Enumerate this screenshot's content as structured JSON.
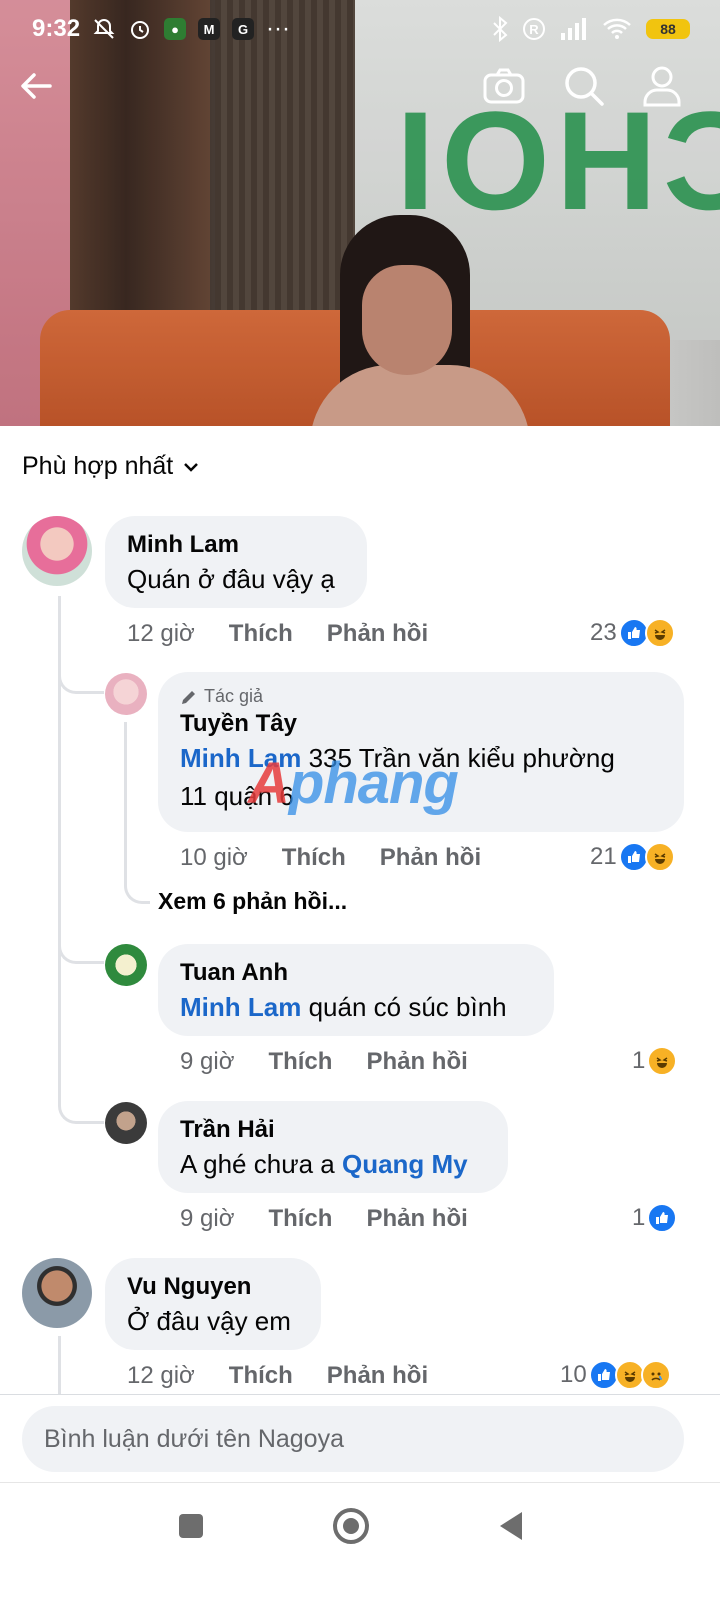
{
  "status_bar": {
    "time": "9:32",
    "battery": "88",
    "app_icons": [
      "M",
      "G"
    ],
    "more": "···"
  },
  "header": {
    "back_icon": "arrow-left-icon",
    "camera_icon": "camera-icon",
    "search_icon": "search-icon",
    "profile_icon": "profile-icon"
  },
  "sort": {
    "label": "Phù hợp nhất"
  },
  "comments": [
    {
      "name": "Minh Lam",
      "text": "Quán ở đâu vậy ạ",
      "time": "12 giờ",
      "like": "Thích",
      "reply": "Phản hồi",
      "reaction_count": "23"
    },
    {
      "author_tag": "Tác giả",
      "name": "Tuyền Tây",
      "mention": "Minh Lam",
      "text_line1": "335 Trần văn kiểu phường",
      "text_line2": "11 quận 6",
      "time": "10 giờ",
      "like": "Thích",
      "reply": "Phản hồi",
      "reaction_count": "21"
    },
    {
      "name": "Tuan Anh",
      "mention": "Minh Lam",
      "text": "quán có súc bình",
      "time": "9 giờ",
      "like": "Thích",
      "reply": "Phản hồi",
      "reaction_count": "1"
    },
    {
      "name": "Trần Hải",
      "text": "A ghé chưa a ",
      "mention": "Quang My",
      "time": "9 giờ",
      "like": "Thích",
      "reply": "Phản hồi",
      "reaction_count": "1"
    },
    {
      "name": "Vu Nguyen",
      "text": "Ở đâu vậy em",
      "time": "12 giờ",
      "like": "Thích",
      "reply": "Phản hồi",
      "reaction_count": "10"
    }
  ],
  "view_more_replies": "Xem 6 phản hồi...",
  "watermark": {
    "a": "A",
    "rest": "phang"
  },
  "input": {
    "placeholder": "Bình luận dưới tên Nagoya"
  },
  "colors": {
    "mention": "#1b67c9",
    "like": "#1877f2",
    "haha": "#f7b125",
    "bubble": "#f0f2f5"
  }
}
